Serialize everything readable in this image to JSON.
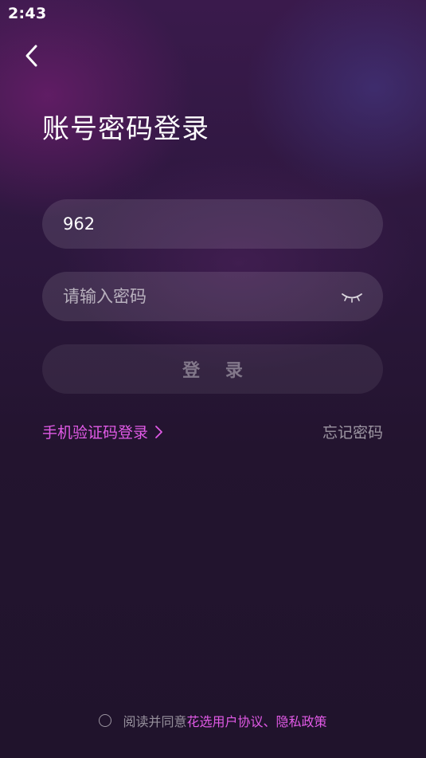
{
  "status_bar": {
    "time": "2:43"
  },
  "header": {
    "title": "账号密码登录"
  },
  "form": {
    "account_value": "962",
    "password_placeholder": "请输入密码",
    "password_toggle_icon": "eye-closed-icon",
    "login_label": "登 录"
  },
  "links": {
    "sms_login": "手机验证码登录",
    "forgot_password": "忘记密码"
  },
  "agreement": {
    "prefix": "阅读并同意",
    "user_agreement": "花选用户协议",
    "separator": "、",
    "privacy_policy": "隐私政策"
  },
  "colors": {
    "accent": "#e15ae6",
    "background": "#22132f"
  }
}
